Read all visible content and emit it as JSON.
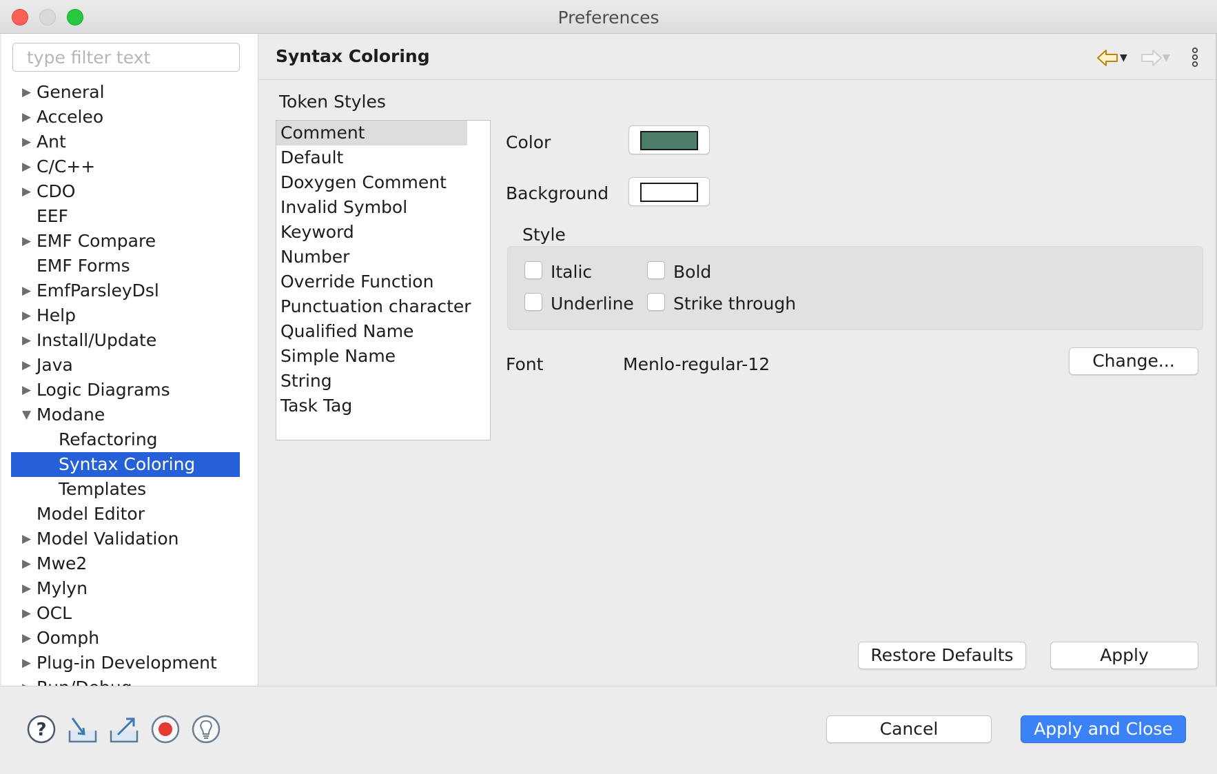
{
  "window": {
    "title": "Preferences"
  },
  "filter": {
    "placeholder": "type filter text",
    "value": ""
  },
  "tree": {
    "items": [
      {
        "label": "General",
        "expandable": true,
        "expanded": false,
        "level": 0
      },
      {
        "label": "Acceleo",
        "expandable": true,
        "expanded": false,
        "level": 0
      },
      {
        "label": "Ant",
        "expandable": true,
        "expanded": false,
        "level": 0
      },
      {
        "label": "C/C++",
        "expandable": true,
        "expanded": false,
        "level": 0
      },
      {
        "label": "CDO",
        "expandable": true,
        "expanded": false,
        "level": 0
      },
      {
        "label": "EEF",
        "expandable": false,
        "expanded": false,
        "level": 0
      },
      {
        "label": "EMF Compare",
        "expandable": true,
        "expanded": false,
        "level": 0
      },
      {
        "label": "EMF Forms",
        "expandable": false,
        "expanded": false,
        "level": 0
      },
      {
        "label": "EmfParsleyDsl",
        "expandable": true,
        "expanded": false,
        "level": 0
      },
      {
        "label": "Help",
        "expandable": true,
        "expanded": false,
        "level": 0
      },
      {
        "label": "Install/Update",
        "expandable": true,
        "expanded": false,
        "level": 0
      },
      {
        "label": "Java",
        "expandable": true,
        "expanded": false,
        "level": 0
      },
      {
        "label": "Logic Diagrams",
        "expandable": true,
        "expanded": false,
        "level": 0
      },
      {
        "label": "Modane",
        "expandable": true,
        "expanded": true,
        "level": 0
      },
      {
        "label": "Refactoring",
        "expandable": false,
        "expanded": false,
        "level": 1
      },
      {
        "label": "Syntax Coloring",
        "expandable": false,
        "expanded": false,
        "level": 1,
        "selected": true
      },
      {
        "label": "Templates",
        "expandable": false,
        "expanded": false,
        "level": 1
      },
      {
        "label": "Model Editor",
        "expandable": false,
        "expanded": false,
        "level": 0
      },
      {
        "label": "Model Validation",
        "expandable": true,
        "expanded": false,
        "level": 0
      },
      {
        "label": "Mwe2",
        "expandable": true,
        "expanded": false,
        "level": 0
      },
      {
        "label": "Mylyn",
        "expandable": true,
        "expanded": false,
        "level": 0
      },
      {
        "label": "OCL",
        "expandable": true,
        "expanded": false,
        "level": 0
      },
      {
        "label": "Oomph",
        "expandable": true,
        "expanded": false,
        "level": 0
      },
      {
        "label": "Plug-in Development",
        "expandable": true,
        "expanded": false,
        "level": 0
      },
      {
        "label": "Run/Debug",
        "expandable": true,
        "expanded": false,
        "level": 0
      }
    ]
  },
  "page": {
    "title": "Syntax Coloring",
    "token_styles_label": "Token Styles",
    "tokens": [
      {
        "label": "Comment",
        "selected": true
      },
      {
        "label": "Default"
      },
      {
        "label": "Doxygen Comment"
      },
      {
        "label": "Invalid Symbol"
      },
      {
        "label": "Keyword"
      },
      {
        "label": "Number"
      },
      {
        "label": "Override Function"
      },
      {
        "label": "Punctuation character"
      },
      {
        "label": "Qualified Name"
      },
      {
        "label": "Simple Name"
      },
      {
        "label": "String"
      },
      {
        "label": "Task Tag"
      }
    ],
    "color_label": "Color",
    "color_value": "#4c7d66",
    "background_label": "Background",
    "background_value": "#ffffff",
    "style_label": "Style",
    "styles": {
      "italic": {
        "label": "Italic",
        "checked": false
      },
      "bold": {
        "label": "Bold",
        "checked": false
      },
      "underline": {
        "label": "Underline",
        "checked": false
      },
      "strike": {
        "label": "Strike through",
        "checked": false
      }
    },
    "font_label": "Font",
    "font_value": "Menlo-regular-12",
    "change_button": "Change...",
    "restore_defaults_button": "Restore Defaults",
    "apply_button": "Apply"
  },
  "nav": {
    "back_icon": "back-arrow-icon",
    "forward_icon": "forward-arrow-icon",
    "menu_icon": "vertical-ellipsis-icon"
  },
  "bottom": {
    "icons": [
      "help-icon",
      "import-icon",
      "export-icon",
      "record-icon",
      "lightbulb-icon"
    ],
    "cancel_button": "Cancel",
    "apply_close_button": "Apply and Close"
  },
  "colors": {
    "selection": "#2560d8",
    "primary_button": "#3b82f6",
    "back_arrow": "#c79b1e"
  }
}
